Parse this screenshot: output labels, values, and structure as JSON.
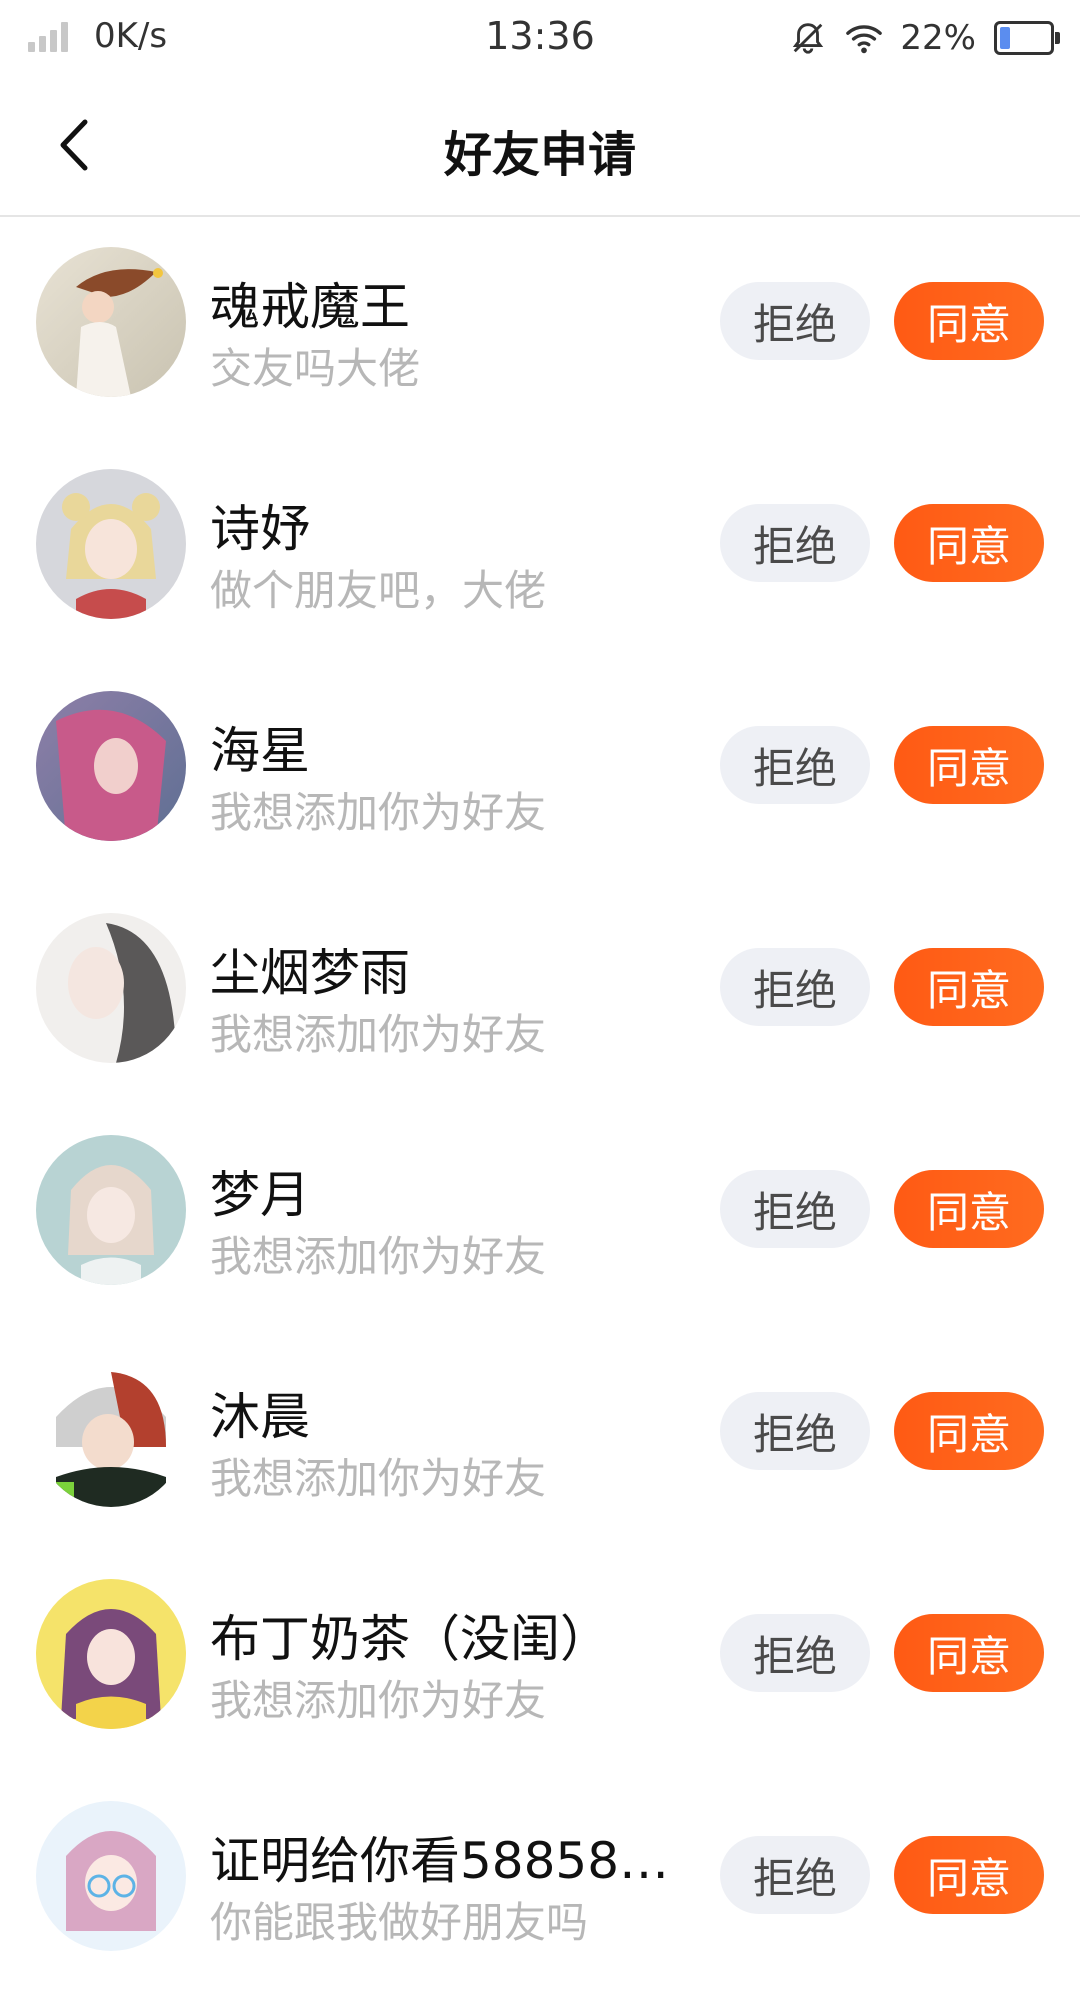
{
  "status_bar": {
    "net_speed": "0K/s",
    "time": "13:36",
    "battery": "22%",
    "icons": [
      "signal-icon",
      "bell-off-icon",
      "wifi-icon",
      "battery-icon"
    ]
  },
  "header": {
    "title": "好友申请",
    "back_icon": "chevron-left-icon"
  },
  "colors": {
    "accept_bg": "#ff5a14",
    "reject_bg": "#eef0f5",
    "message_text": "#b7b7b7"
  },
  "requests": [
    {
      "name": "魂戒魔王",
      "message": "交友吗大佬",
      "reject": "拒绝",
      "accept": "同意"
    },
    {
      "name": "诗妤",
      "message": "做个朋友吧，大佬",
      "reject": "拒绝",
      "accept": "同意"
    },
    {
      "name": "海星",
      "message": "我想添加你为好友",
      "reject": "拒绝",
      "accept": "同意"
    },
    {
      "name": "尘烟梦雨",
      "message": "我想添加你为好友",
      "reject": "拒绝",
      "accept": "同意"
    },
    {
      "name": "梦月",
      "message": "我想添加你为好友",
      "reject": "拒绝",
      "accept": "同意"
    },
    {
      "name": "沐晨",
      "message": "我想添加你为好友",
      "reject": "拒绝",
      "accept": "同意"
    },
    {
      "name": "布丁奶茶（没闺）",
      "message": "我想添加你为好友",
      "reject": "拒绝",
      "accept": "同意"
    },
    {
      "name": "证明给你看58858…",
      "message": "你能跟我做好朋友吗",
      "reject": "拒绝",
      "accept": "同意"
    }
  ]
}
